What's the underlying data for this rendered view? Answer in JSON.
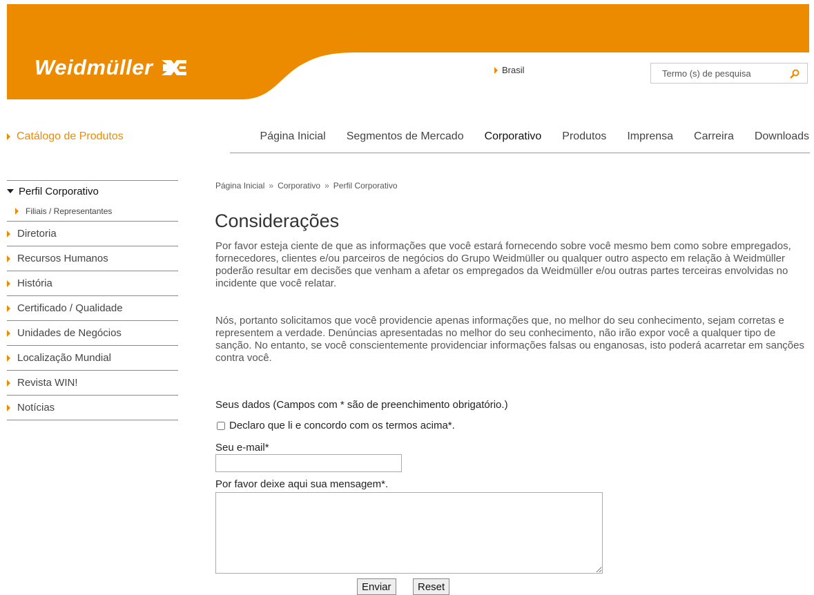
{
  "header": {
    "brand": "Weidmüller",
    "country": "Brasil",
    "search_placeholder": "Termo (s) de pesquisa",
    "brand_color": "#ed8b00"
  },
  "nav": {
    "catalog": "Catálogo de Produtos",
    "items": [
      "Página Inicial",
      "Segmentos de Mercado",
      "Corporativo",
      "Produtos",
      "Imprensa",
      "Carreira",
      "Downloads"
    ],
    "active": "Corporativo"
  },
  "sidebar": {
    "open_item": "Perfil Corporativo",
    "sub_item": "Filiais / Representantes",
    "items": [
      "Diretoria",
      "Recursos Humanos",
      "História",
      "Certificado / Qualidade",
      "Unidades de Negócios",
      "Localização Mundial",
      "Revista WIN!",
      "Notícias"
    ]
  },
  "breadcrumb": [
    "Página Inicial",
    "Corporativo",
    "Perfil Corporativo"
  ],
  "main": {
    "title": "Considerações",
    "paragraph1": "Por favor esteja ciente de que as informações que você estará fornecendo sobre você mesmo bem como sobre empregados, fornecedores, clientes e/ou parceiros de negócios do Grupo Weidmüller ou qualquer outro aspecto em relação à Weidmüller poderão resultar em decisões que venham a afetar os empregados da Weidmüller e/ou outras partes terceiras envolvidas no incidente que você relatar.",
    "paragraph2": "Nós, portanto solicitamos que você providencie apenas informações que, no melhor do seu conhecimento, sejam corretas e representem a verdade. Denúncias apresentadas no melhor do seu conhecimento, não irão expor você a qualquer tipo de sanção. No entanto, se você conscientemente providenciar informações falsas ou enganosas, isto poderá acarretar em sanções contra você."
  },
  "form": {
    "title": "Seus dados (Campos com * são de preenchimento obrigatório.)",
    "agree_label": "Declaro que li e concordo com os termos acima*.",
    "email_label": "Seu e-mail*",
    "email_value": "",
    "message_label": "Por favor deixe aqui sua mensagem*.",
    "message_value": "",
    "submit_label": "Enviar",
    "reset_label": "Reset"
  }
}
